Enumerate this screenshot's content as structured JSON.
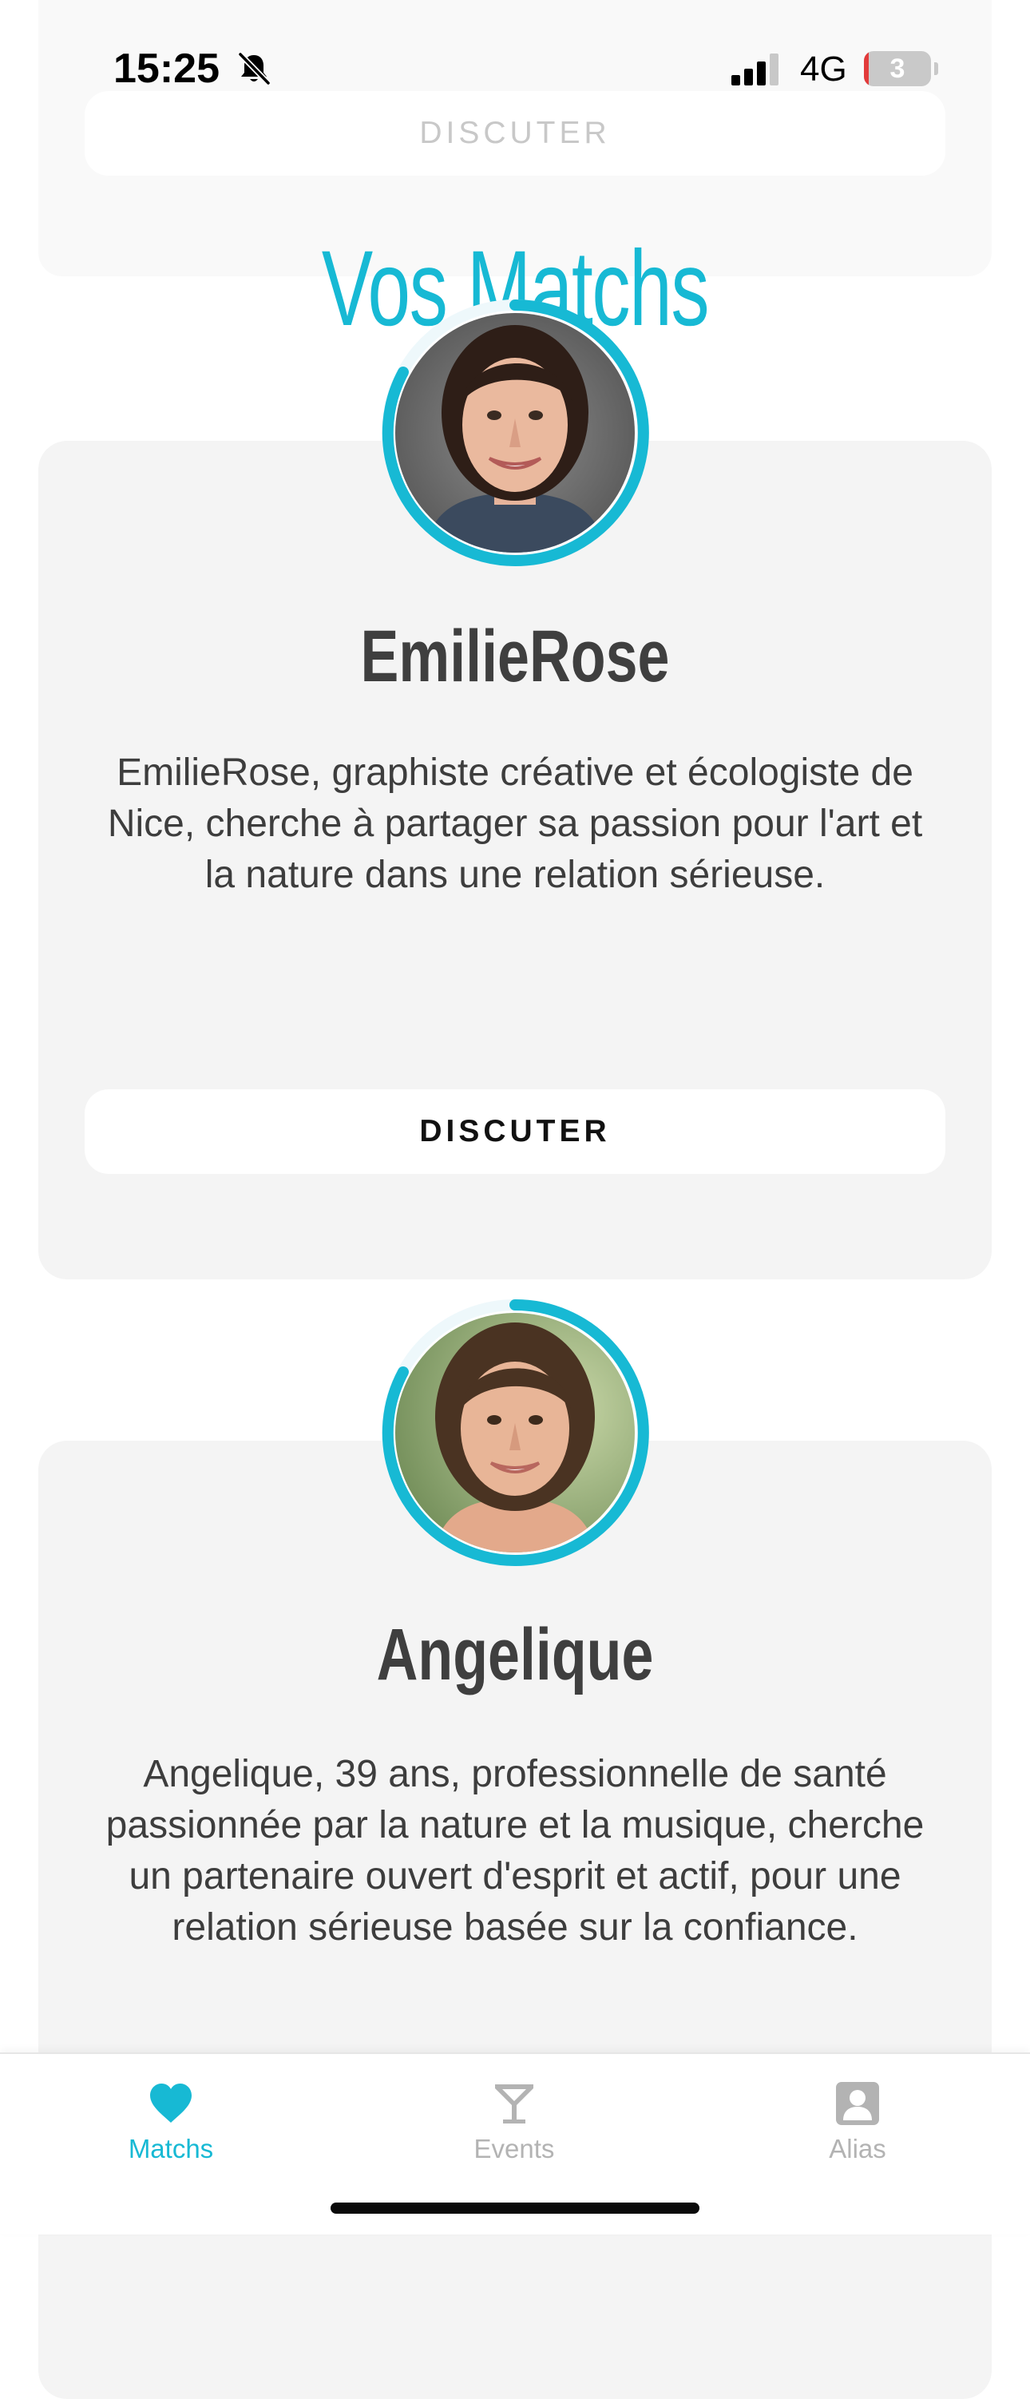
{
  "status_bar": {
    "time": "15:25",
    "network": "4G",
    "battery_level": "3",
    "battery_fraction": 0.03,
    "icons": [
      "bell-slash-icon",
      "signal-icon",
      "battery-icon"
    ]
  },
  "top_card": {
    "button_label": "DISCUTER"
  },
  "page_title": "Vos Matchs",
  "matches": [
    {
      "name": "EmilieRose",
      "bio": "EmilieRose, graphiste créative et écologiste de Nice, cherche à partager sa passion pour l'art et la nature dans une relation sérieuse.",
      "button_label": "DISCUTER"
    },
    {
      "name": "Angelique",
      "bio": "Angelique, 39 ans, professionnelle de santé passionnée par la nature et la musique, cherche un partenaire ouvert d'esprit et actif, pour une relation sérieuse basée sur la confiance."
    }
  ],
  "tab_bar": {
    "tabs": [
      {
        "label": "Matchs",
        "icon": "heart-icon",
        "active": true
      },
      {
        "label": "Events",
        "icon": "cocktail-glass-icon",
        "active": false
      },
      {
        "label": "Alias",
        "icon": "profile-icon",
        "active": false
      }
    ]
  },
  "colors": {
    "accent": "#17b9d4",
    "card_background": "#f4f4f4",
    "inactive": "#b3b3b3",
    "text": "#3d3d3d"
  }
}
